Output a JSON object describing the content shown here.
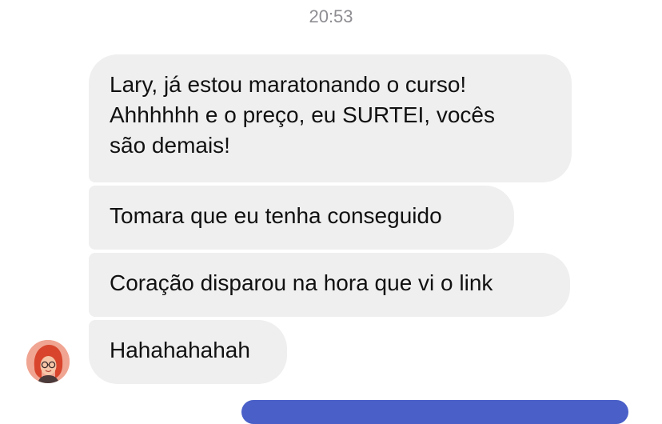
{
  "timestamp": "20:53",
  "messages": [
    {
      "lines": [
        "Lary, já estou maratonando o curso!",
        "Ahhhhhh e o preço, eu SURTEI, vocês",
        "são demais!"
      ]
    },
    {
      "text": "Tomara que eu tenha conseguido"
    },
    {
      "text": "Coração disparou na hora que vi o link"
    },
    {
      "text": "Hahahahahah"
    }
  ],
  "colors": {
    "incoming_bubble": "#efefef",
    "outgoing_bubble": "#4a5fc8",
    "timestamp": "#8e8e93"
  }
}
